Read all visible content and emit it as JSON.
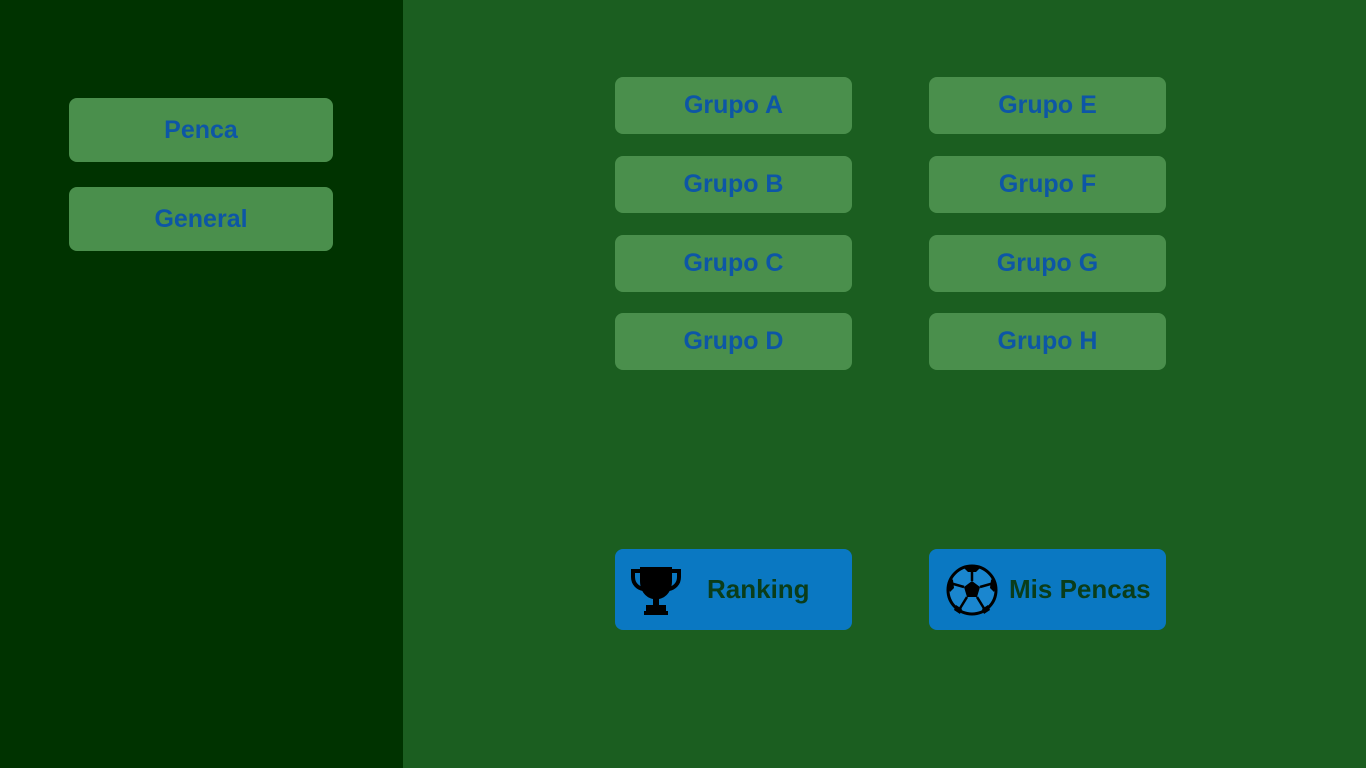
{
  "sidebar": {
    "items": [
      {
        "label": "Penca"
      },
      {
        "label": "General"
      }
    ]
  },
  "groups": {
    "items": [
      {
        "label": "Grupo A"
      },
      {
        "label": "Grupo B"
      },
      {
        "label": "Grupo C"
      },
      {
        "label": "Grupo D"
      },
      {
        "label": "Grupo E"
      },
      {
        "label": "Grupo F"
      },
      {
        "label": "Grupo G"
      },
      {
        "label": "Grupo H"
      }
    ]
  },
  "actions": {
    "ranking": {
      "label": "Ranking",
      "icon": "trophy-icon"
    },
    "mis_pencas": {
      "label": "Mis Pencas",
      "icon": "soccer-ball-icon"
    }
  },
  "colors": {
    "main_background": "#1b5e20",
    "sidebar_background": "#003300",
    "button_background": "#4a8f4c",
    "button_text": "#0d56a6",
    "action_background": "#0a78c2",
    "action_text": "#0a3d1a"
  }
}
